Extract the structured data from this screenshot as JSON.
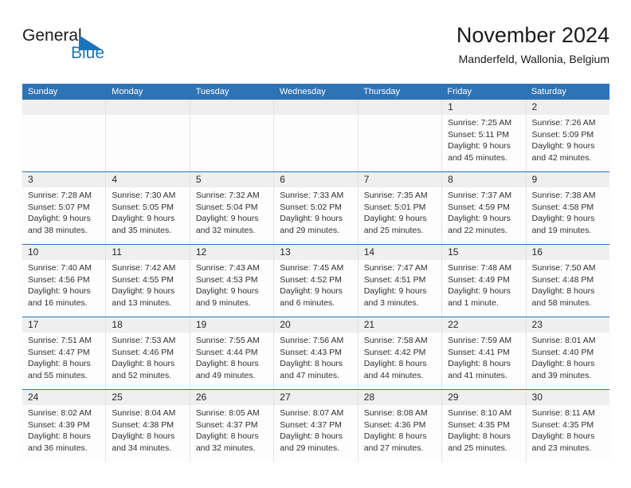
{
  "logo": {
    "word1": "General",
    "word2": "Blue",
    "triangle_color": "#1c75bc",
    "icon": "triangle-icon"
  },
  "header": {
    "title": "November 2024",
    "subtitle": "Manderfeld, Wallonia, Belgium"
  },
  "colors": {
    "header_bar": "#2e73b5",
    "daynum_band": "#efefef",
    "cell_bg": "#fdfdfd",
    "grid_line": "#e3e3e3",
    "text": "#303030",
    "brand_blue": "#1c75bc"
  },
  "weekdays": [
    "Sunday",
    "Monday",
    "Tuesday",
    "Wednesday",
    "Thursday",
    "Friday",
    "Saturday"
  ],
  "weeks": [
    [
      {
        "day": "",
        "lines": []
      },
      {
        "day": "",
        "lines": []
      },
      {
        "day": "",
        "lines": []
      },
      {
        "day": "",
        "lines": []
      },
      {
        "day": "",
        "lines": []
      },
      {
        "day": "1",
        "lines": [
          "Sunrise: 7:25 AM",
          "Sunset: 5:11 PM",
          "Daylight: 9 hours",
          "and 45 minutes."
        ]
      },
      {
        "day": "2",
        "lines": [
          "Sunrise: 7:26 AM",
          "Sunset: 5:09 PM",
          "Daylight: 9 hours",
          "and 42 minutes."
        ]
      }
    ],
    [
      {
        "day": "3",
        "lines": [
          "Sunrise: 7:28 AM",
          "Sunset: 5:07 PM",
          "Daylight: 9 hours",
          "and 38 minutes."
        ]
      },
      {
        "day": "4",
        "lines": [
          "Sunrise: 7:30 AM",
          "Sunset: 5:05 PM",
          "Daylight: 9 hours",
          "and 35 minutes."
        ]
      },
      {
        "day": "5",
        "lines": [
          "Sunrise: 7:32 AM",
          "Sunset: 5:04 PM",
          "Daylight: 9 hours",
          "and 32 minutes."
        ]
      },
      {
        "day": "6",
        "lines": [
          "Sunrise: 7:33 AM",
          "Sunset: 5:02 PM",
          "Daylight: 9 hours",
          "and 29 minutes."
        ]
      },
      {
        "day": "7",
        "lines": [
          "Sunrise: 7:35 AM",
          "Sunset: 5:01 PM",
          "Daylight: 9 hours",
          "and 25 minutes."
        ]
      },
      {
        "day": "8",
        "lines": [
          "Sunrise: 7:37 AM",
          "Sunset: 4:59 PM",
          "Daylight: 9 hours",
          "and 22 minutes."
        ]
      },
      {
        "day": "9",
        "lines": [
          "Sunrise: 7:38 AM",
          "Sunset: 4:58 PM",
          "Daylight: 9 hours",
          "and 19 minutes."
        ]
      }
    ],
    [
      {
        "day": "10",
        "lines": [
          "Sunrise: 7:40 AM",
          "Sunset: 4:56 PM",
          "Daylight: 9 hours",
          "and 16 minutes."
        ]
      },
      {
        "day": "11",
        "lines": [
          "Sunrise: 7:42 AM",
          "Sunset: 4:55 PM",
          "Daylight: 9 hours",
          "and 13 minutes."
        ]
      },
      {
        "day": "12",
        "lines": [
          "Sunrise: 7:43 AM",
          "Sunset: 4:53 PM",
          "Daylight: 9 hours",
          "and 9 minutes."
        ]
      },
      {
        "day": "13",
        "lines": [
          "Sunrise: 7:45 AM",
          "Sunset: 4:52 PM",
          "Daylight: 9 hours",
          "and 6 minutes."
        ]
      },
      {
        "day": "14",
        "lines": [
          "Sunrise: 7:47 AM",
          "Sunset: 4:51 PM",
          "Daylight: 9 hours",
          "and 3 minutes."
        ]
      },
      {
        "day": "15",
        "lines": [
          "Sunrise: 7:48 AM",
          "Sunset: 4:49 PM",
          "Daylight: 9 hours",
          "and 1 minute."
        ]
      },
      {
        "day": "16",
        "lines": [
          "Sunrise: 7:50 AM",
          "Sunset: 4:48 PM",
          "Daylight: 8 hours",
          "and 58 minutes."
        ]
      }
    ],
    [
      {
        "day": "17",
        "lines": [
          "Sunrise: 7:51 AM",
          "Sunset: 4:47 PM",
          "Daylight: 8 hours",
          "and 55 minutes."
        ]
      },
      {
        "day": "18",
        "lines": [
          "Sunrise: 7:53 AM",
          "Sunset: 4:46 PM",
          "Daylight: 8 hours",
          "and 52 minutes."
        ]
      },
      {
        "day": "19",
        "lines": [
          "Sunrise: 7:55 AM",
          "Sunset: 4:44 PM",
          "Daylight: 8 hours",
          "and 49 minutes."
        ]
      },
      {
        "day": "20",
        "lines": [
          "Sunrise: 7:56 AM",
          "Sunset: 4:43 PM",
          "Daylight: 8 hours",
          "and 47 minutes."
        ]
      },
      {
        "day": "21",
        "lines": [
          "Sunrise: 7:58 AM",
          "Sunset: 4:42 PM",
          "Daylight: 8 hours",
          "and 44 minutes."
        ]
      },
      {
        "day": "22",
        "lines": [
          "Sunrise: 7:59 AM",
          "Sunset: 4:41 PM",
          "Daylight: 8 hours",
          "and 41 minutes."
        ]
      },
      {
        "day": "23",
        "lines": [
          "Sunrise: 8:01 AM",
          "Sunset: 4:40 PM",
          "Daylight: 8 hours",
          "and 39 minutes."
        ]
      }
    ],
    [
      {
        "day": "24",
        "lines": [
          "Sunrise: 8:02 AM",
          "Sunset: 4:39 PM",
          "Daylight: 8 hours",
          "and 36 minutes."
        ]
      },
      {
        "day": "25",
        "lines": [
          "Sunrise: 8:04 AM",
          "Sunset: 4:38 PM",
          "Daylight: 8 hours",
          "and 34 minutes."
        ]
      },
      {
        "day": "26",
        "lines": [
          "Sunrise: 8:05 AM",
          "Sunset: 4:37 PM",
          "Daylight: 8 hours",
          "and 32 minutes."
        ]
      },
      {
        "day": "27",
        "lines": [
          "Sunrise: 8:07 AM",
          "Sunset: 4:37 PM",
          "Daylight: 8 hours",
          "and 29 minutes."
        ]
      },
      {
        "day": "28",
        "lines": [
          "Sunrise: 8:08 AM",
          "Sunset: 4:36 PM",
          "Daylight: 8 hours",
          "and 27 minutes."
        ]
      },
      {
        "day": "29",
        "lines": [
          "Sunrise: 8:10 AM",
          "Sunset: 4:35 PM",
          "Daylight: 8 hours",
          "and 25 minutes."
        ]
      },
      {
        "day": "30",
        "lines": [
          "Sunrise: 8:11 AM",
          "Sunset: 4:35 PM",
          "Daylight: 8 hours",
          "and 23 minutes."
        ]
      }
    ]
  ]
}
